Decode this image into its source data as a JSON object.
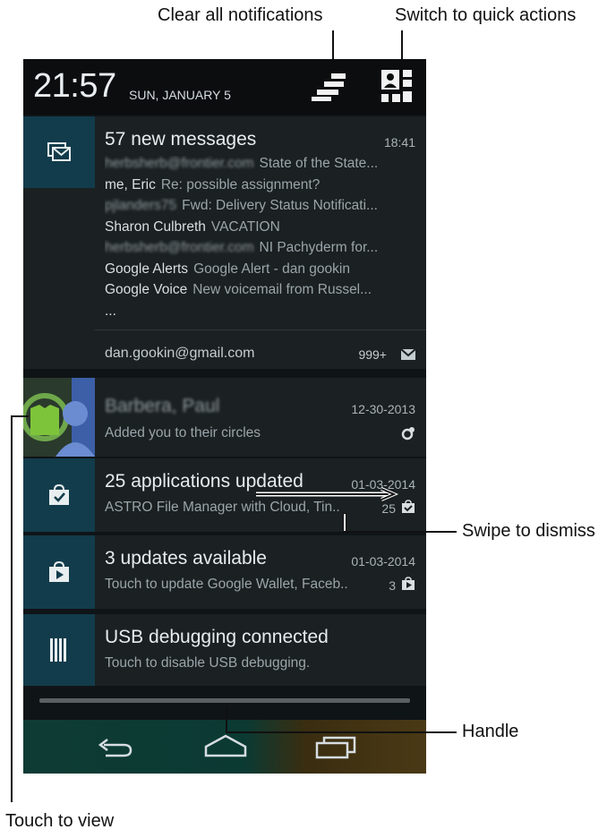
{
  "callouts": {
    "clear_all": "Clear all notifications",
    "switch_quick": "Switch to quick actions",
    "swipe": "Swipe to dismiss",
    "handle": "Handle",
    "touch": "Touch to view"
  },
  "status": {
    "time": "21:57",
    "date": "SUN, JANUARY 5"
  },
  "gmail": {
    "title": "57 new messages",
    "time": "18:41",
    "rows": [
      {
        "sender": "herbsherb@frontier.com",
        "subject": "State of the State...",
        "blurred": true
      },
      {
        "sender": "me, Eric",
        "subject": "Re: possible assignment?",
        "blurred": false
      },
      {
        "sender": "pjlanders75",
        "subject": "Fwd: Delivery Status Notificati...",
        "blurred": true
      },
      {
        "sender": "Sharon Culbreth",
        "subject": "VACATION",
        "blurred": false
      },
      {
        "sender": "herbsherb@frontier.com",
        "subject": "NI Pachyderm for...",
        "blurred": true
      },
      {
        "sender": "Google Alerts",
        "subject": "Google Alert - dan gookin",
        "blurred": false
      },
      {
        "sender": "Google Voice",
        "subject": "New voicemail from Russel...",
        "blurred": false
      },
      {
        "sender": "...",
        "subject": "",
        "blurred": false
      }
    ],
    "account": "dan.gookin@gmail.com",
    "count": "999+"
  },
  "gplus": {
    "title": "Barbera, Paul",
    "subtitle": "Added you to their circles",
    "time": "12-30-2013"
  },
  "apps_updated": {
    "title": "25 applications updated",
    "subtitle": "ASTRO File Manager with Cloud, Tin..",
    "time": "01-03-2014",
    "count": "25"
  },
  "updates": {
    "title": "3 updates available",
    "subtitle": "Touch to update Google Wallet, Faceb..",
    "time": "01-03-2014",
    "count": "3"
  },
  "usb": {
    "title": "USB debugging connected",
    "subtitle": "Touch to disable USB debugging."
  },
  "colors": {
    "icon_bg": "#123c4b",
    "panel_bg": "#1b2022",
    "status_bg": "#0b0d0e"
  }
}
